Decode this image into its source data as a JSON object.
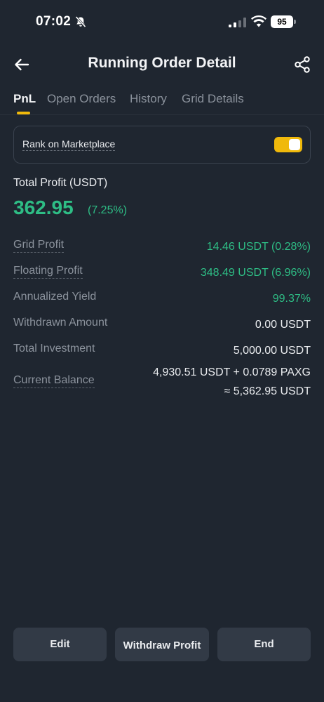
{
  "status_bar": {
    "time": "07:02",
    "battery": "95"
  },
  "header": {
    "title": "Running Order Detail",
    "back_icon": "arrow-left-icon",
    "share_icon": "share-icon"
  },
  "tabs": [
    {
      "label": "PnL",
      "active": true
    },
    {
      "label": "Open Orders",
      "active": false
    },
    {
      "label": "History",
      "active": false
    },
    {
      "label": "Grid Details",
      "active": false
    }
  ],
  "rank": {
    "label": "Rank on Marketplace",
    "enabled": true
  },
  "profit": {
    "label": "Total Profit (USDT)",
    "value": "362.95",
    "percent": "(7.25%)"
  },
  "details": [
    {
      "label": "Grid Profit",
      "value": "14.46 USDT (0.28%)"
    },
    {
      "label": "Floating Profit",
      "value": "348.49 USDT (6.96%)"
    },
    {
      "label": "Annualized Yield",
      "value": "99.37%"
    },
    {
      "label": "Withdrawn Amount",
      "value": "0.00 USDT"
    },
    {
      "label": "Total Investment",
      "value": "5,000.00 USDT"
    },
    {
      "label": "Current Balance",
      "value_line1": "4,930.51 USDT + 0.0789 PAXG",
      "value_line2": "≈ 5,362.95 USDT"
    }
  ],
  "actions": {
    "edit": "Edit",
    "withdraw": "Withdraw Profit",
    "end": "End"
  },
  "colors": {
    "background": "#1f2630",
    "accent": "#f0b90b",
    "profit_green": "#2ebd85"
  }
}
